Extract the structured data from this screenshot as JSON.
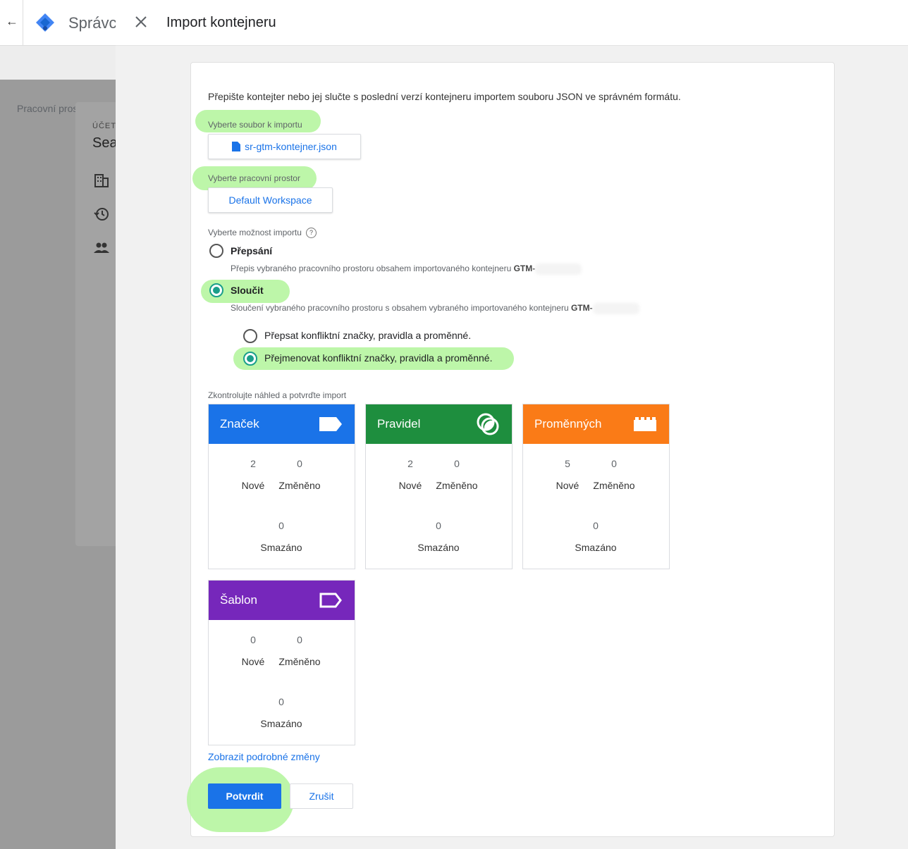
{
  "background": {
    "title": "Správc",
    "subbar": "Pracovní prostor",
    "account_label": "ÚČET",
    "account_name": "Sea"
  },
  "dialog": {
    "title": "Import kontejneru",
    "intro": "Přepište kontejter nebo jej slučte s poslední verzí kontejneru importem souboru JSON ve správném formátu.",
    "file_label": "Vyberte soubor k importu",
    "file_name": "sr-gtm-kontejner.json",
    "workspace_label": "Vyberte pracovní prostor",
    "workspace_name": "Default Workspace",
    "import_option_label": "Vyberte možnost importu",
    "help_glyph": "?",
    "options": [
      {
        "title": "Přepsání",
        "desc": "Přepis vybraného pracovního prostoru obsahem importovaného kontejneru ",
        "gtm": "GTM-",
        "selected": false
      },
      {
        "title": "Sloučit",
        "desc": "Sloučení vybraného pracovního prostoru s obsahem vybraného importovaného kontejneru ",
        "gtm": "GTM-",
        "selected": true
      }
    ],
    "merge_options": [
      {
        "label": "Přepsat konfliktní značky, pravidla a proměnné.",
        "selected": false
      },
      {
        "label": "Přejmenovat konfliktní značky, pravidla a proměnné.",
        "selected": true
      }
    ],
    "preview_label": "Zkontrolujte náhled a potvrďte import",
    "tiles": [
      {
        "title": "Značek",
        "color": "#1a73e8",
        "icon": "tag-icon",
        "new": "2",
        "changed": "0",
        "deleted": "0"
      },
      {
        "title": "Pravidel",
        "color": "#1e8e3e",
        "icon": "trigger-icon",
        "new": "2",
        "changed": "0",
        "deleted": "0"
      },
      {
        "title": "Proměnných",
        "color": "#fa7b17",
        "icon": "variable-icon",
        "new": "5",
        "changed": "0",
        "deleted": "0"
      },
      {
        "title": "Šablon",
        "color": "#7627bb",
        "icon": "template-icon",
        "new": "0",
        "changed": "0",
        "deleted": "0"
      }
    ],
    "labels": {
      "new": "Nové",
      "changed": "Změněno",
      "deleted": "Smazáno"
    },
    "details_link": "Zobrazit podrobné změny",
    "confirm": "Potvrdit",
    "cancel": "Zrušit"
  }
}
